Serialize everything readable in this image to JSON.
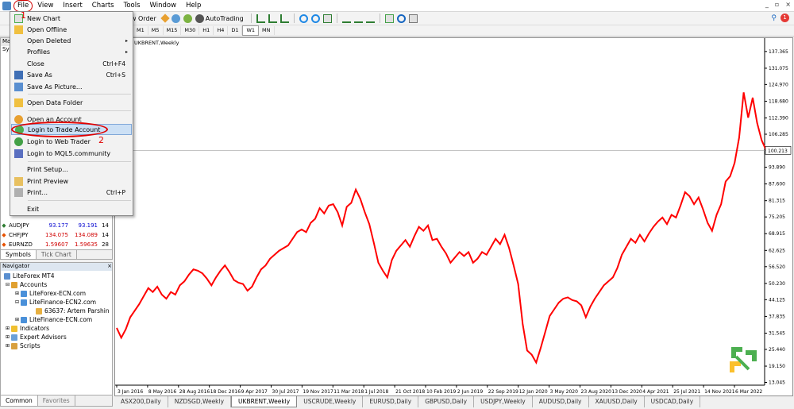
{
  "menubar": {
    "items": [
      "File",
      "View",
      "Insert",
      "Charts",
      "Tools",
      "Window",
      "Help"
    ]
  },
  "toolbar1": {
    "new_order": "ew Order",
    "autotrading": "AutoTrading"
  },
  "toolbar2": {
    "timeframes": [
      "M1",
      "M5",
      "M15",
      "M30",
      "H1",
      "H4",
      "D1",
      "W1",
      "MN"
    ],
    "active_timeframe": "W1"
  },
  "market_watch": {
    "title": "Ma",
    "header_col": "Sy",
    "rows": [
      {
        "symbol": "AUDJPY",
        "bid": "93.177",
        "ask": "93.191",
        "spread": "14",
        "dir": "up"
      },
      {
        "symbol": "CHFJPY",
        "bid": "134.075",
        "ask": "134.089",
        "spread": "14",
        "dir": "down"
      },
      {
        "symbol": "EURNZD",
        "bid": "1.59607",
        "ask": "1.59635",
        "spread": "28",
        "dir": "down"
      }
    ],
    "tabs": [
      "Symbols",
      "Tick Chart"
    ]
  },
  "navigator": {
    "title": "Navigator",
    "nodes": [
      {
        "label": "LiteForex MT4",
        "level": 0
      },
      {
        "label": "Accounts",
        "level": 1
      },
      {
        "label": "LiteForex-ECN.com",
        "level": 2
      },
      {
        "label": "LiteFinance-ECN2.com",
        "level": 2
      },
      {
        "label": "63637: Artem Parshin",
        "level": 3
      },
      {
        "label": "LiteFinance-ECN.com",
        "level": 2
      },
      {
        "label": "Indicators",
        "level": 1
      },
      {
        "label": "Expert Advisors",
        "level": 1
      },
      {
        "label": "Scripts",
        "level": 1
      }
    ],
    "tabs": [
      "Common",
      "Favorites"
    ]
  },
  "file_menu": {
    "items": [
      {
        "label": "New Chart",
        "shortcut": "",
        "submenu": false
      },
      {
        "label": "Open Offline",
        "shortcut": "",
        "submenu": false
      },
      {
        "label": "Open Deleted",
        "shortcut": "",
        "submenu": true
      },
      {
        "label": "Profiles",
        "shortcut": "",
        "submenu": true
      },
      {
        "label": "Close",
        "shortcut": "Ctrl+F4",
        "submenu": false
      },
      {
        "label": "Save As",
        "shortcut": "Ctrl+S",
        "submenu": false
      },
      {
        "label": "Save As Picture...",
        "shortcut": "",
        "submenu": false
      },
      {
        "label": "Open Data Folder",
        "shortcut": "",
        "submenu": false
      },
      {
        "label": "Open an Account",
        "shortcut": "",
        "submenu": false
      },
      {
        "label": "Login to Trade Account",
        "shortcut": "",
        "submenu": false
      },
      {
        "label": "Login to Web Trader",
        "shortcut": "",
        "submenu": false
      },
      {
        "label": "Login to MQL5.community",
        "shortcut": "",
        "submenu": false
      },
      {
        "label": "Print Setup...",
        "shortcut": "",
        "submenu": false
      },
      {
        "label": "Print Preview",
        "shortcut": "",
        "submenu": false
      },
      {
        "label": "Print...",
        "shortcut": "Ctrl+P",
        "submenu": false
      },
      {
        "label": "Exit",
        "shortcut": "",
        "submenu": false
      }
    ],
    "highlighted": "Login to Trade Account"
  },
  "annotations": {
    "step1": "1",
    "step2": "2"
  },
  "chart": {
    "title": "UKBRENT,Weekly",
    "current_price": "100.213",
    "line_color": "#ff0000"
  },
  "chart_data": {
    "type": "line",
    "title": "UKBRENT,Weekly",
    "ylabel": "",
    "xlabel": "",
    "ylim": [
      12.0,
      140.0
    ],
    "y_ticks": [
      "137.365",
      "131.075",
      "124.970",
      "118.680",
      "112.390",
      "106.285",
      "100.213",
      "93.890",
      "87.600",
      "81.315",
      "75.205",
      "68.915",
      "62.625",
      "56.520",
      "50.230",
      "44.125",
      "37.835",
      "31.545",
      "25.440",
      "19.150",
      "13.045"
    ],
    "x_ticks": [
      "3 Jan 2016",
      "8 May 2016",
      "28 Aug 2016",
      "18 Dec 2016",
      "9 Apr 2017",
      "30 Jul 2017",
      "19 Nov 2017",
      "11 Mar 2018",
      "1 Jul 2018",
      "21 Oct 2018",
      "10 Feb 2019",
      "2 Jun 2019",
      "22 Sep 2019",
      "12 Jan 2020",
      "3 May 2020",
      "23 Aug 2020",
      "13 Dec 2020",
      "4 Apr 2021",
      "25 Jul 2021",
      "14 Nov 2021",
      "6 Mar 2022"
    ],
    "series": [
      {
        "values": [
          33.5,
          29.8,
          33.0,
          37.5,
          40.0,
          42.5,
          45.5,
          48.5,
          47.0,
          49.0,
          46.0,
          44.5,
          47.0,
          46.0,
          49.5,
          51.0,
          53.5,
          55.5,
          55.0,
          54.0,
          52.0,
          49.5,
          52.5,
          55.0,
          57.0,
          54.5,
          51.5,
          50.5,
          50.0,
          47.5,
          49.0,
          52.5,
          55.5,
          57.0,
          59.5,
          61.0,
          62.5,
          63.5,
          64.5,
          67.0,
          69.5,
          70.5,
          69.5,
          73.0,
          74.5,
          78.5,
          76.5,
          79.5,
          80.0,
          77.0,
          72.0,
          79.0,
          80.5,
          85.5,
          82.0,
          77.0,
          72.5,
          65.5,
          58.0,
          55.0,
          52.5,
          59.0,
          62.5,
          64.5,
          66.5,
          64.0,
          68.0,
          71.5,
          70.0,
          72.0,
          66.5,
          67.0,
          64.0,
          61.5,
          58.0,
          60.0,
          62.0,
          60.5,
          62.0,
          58.0,
          59.5,
          62.0,
          61.0,
          64.0,
          67.0,
          65.0,
          68.5,
          63.5,
          57.0,
          50.0,
          35.0,
          25.0,
          23.5,
          20.5,
          26.0,
          32.0,
          38.0,
          40.5,
          43.0,
          44.5,
          45.0,
          44.0,
          43.5,
          42.0,
          37.5,
          41.5,
          44.5,
          47.0,
          49.5,
          51.0,
          52.5,
          56.0,
          61.0,
          64.0,
          67.0,
          65.5,
          68.5,
          66.0,
          69.0,
          71.5,
          73.5,
          75.0,
          72.5,
          76.0,
          75.0,
          79.5,
          84.5,
          83.0,
          80.0,
          82.5,
          78.0,
          73.0,
          70.0,
          76.0,
          80.0,
          88.5,
          90.5,
          95.5,
          105.0,
          122.0,
          112.5,
          120.0,
          110.5,
          104.0,
          100.2
        ]
      }
    ]
  },
  "chart_tabs": [
    "ASX200,Daily",
    "NZDSGD,Weekly",
    "UKBRENT,Weekly",
    "USCRUDE,Weekly",
    "EURUSD,Daily",
    "GBPUSD,Daily",
    "USDJPY,Weekly",
    "AUDUSD,Daily",
    "XAUUSD,Daily",
    "USDCAD,Daily"
  ],
  "active_chart_tab": "UKBRENT,Weekly"
}
